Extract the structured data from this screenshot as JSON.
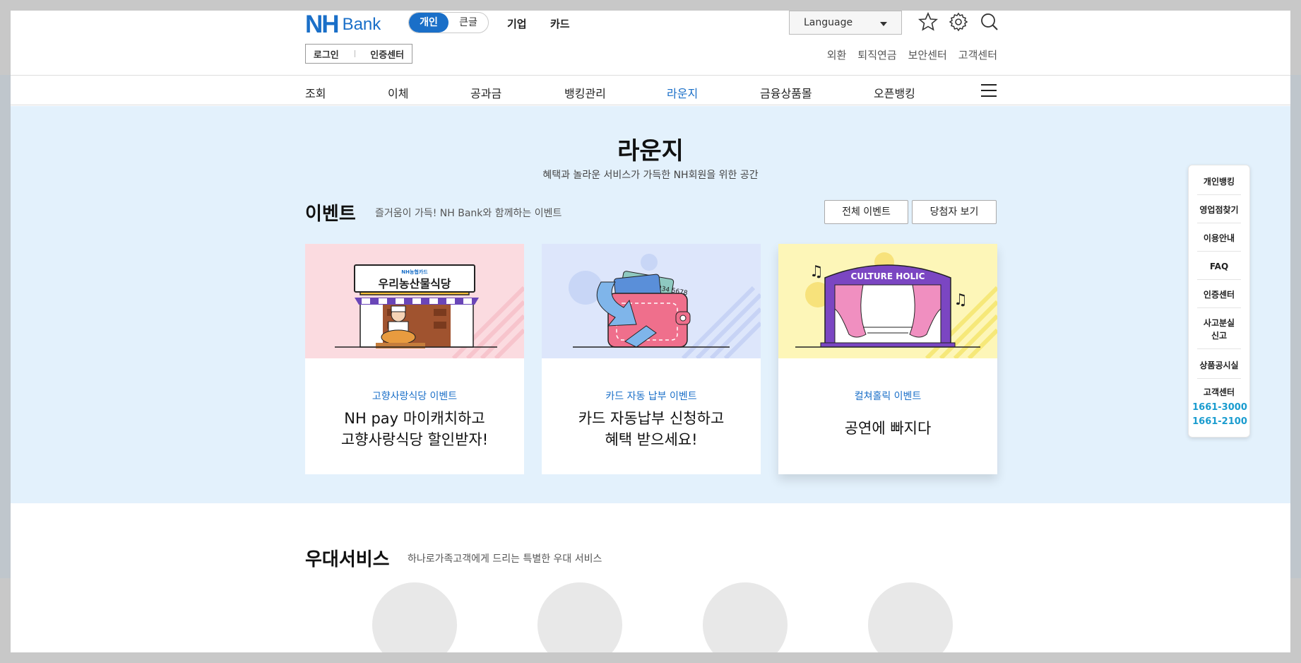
{
  "header": {
    "logo_nh": "NH",
    "logo_bank": "Bank",
    "seg_personal": "개인",
    "seg_large_text": "큰글",
    "menu_business": "기업",
    "menu_card": "카드",
    "language": "Language",
    "login": "로그인",
    "cert_center": "인증센터",
    "utils": [
      "외환",
      "퇴직연금",
      "보안센터",
      "고객센터"
    ]
  },
  "gnb": [
    "조회",
    "이체",
    "공과금",
    "뱅킹관리",
    "라운지",
    "금융상품몰",
    "오픈뱅킹"
  ],
  "lounge": {
    "title": "라운지",
    "subtitle": "혜택과 놀라운 서비스가 가득한 NH회원을 위한 공간",
    "events_title": "이벤트",
    "events_subtitle": "즐거움이 가득! NH Bank와 함께하는 이벤트",
    "btn_all_events": "전체 이벤트",
    "btn_winners": "당첨자 보기"
  },
  "cards": [
    {
      "category": "고향사랑식당 이벤트",
      "headline": "NH pay 마이캐치하고\n고향사랑식당 할인받자!",
      "sign_small": "NH농협카드",
      "sign_big": "우리농산물식당",
      "bg": "#fbdbe0"
    },
    {
      "category": "카드 자동 납부 이벤트",
      "headline": "카드 자동납부 신청하고\n혜택 받으세요!",
      "card_number": "1234 5678",
      "bg": "#dde6fb"
    },
    {
      "category": "컬쳐홀릭 이벤트",
      "headline": "공연에 빠지다",
      "stage_sign": "CULTURE HOLIC",
      "bg": "#fdf6b8"
    }
  ],
  "quick_menu": {
    "items": [
      "개인뱅킹",
      "영업점찾기",
      "이용안내",
      "FAQ",
      "인증센터",
      "사고분실\n신고",
      "상품공시실",
      "고객센터"
    ],
    "tel1": "1661-3000",
    "tel2": "1661-2100"
  },
  "benefits": {
    "title": "우대서비스",
    "subtitle": "하나로가족고객에게 드리는 특별한 우대 서비스"
  },
  "colors": {
    "brand": "#1a6fc8",
    "lounge_bg": "#e3f1fc",
    "tel": "#1a9ccf"
  }
}
